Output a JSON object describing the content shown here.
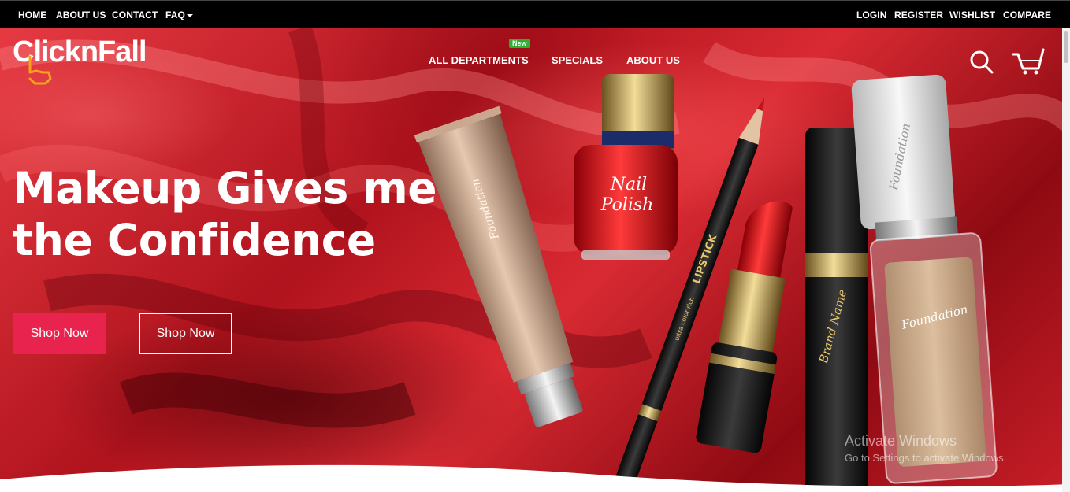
{
  "topbar": {
    "left_links": [
      "HOME",
      "ABOUT US",
      "CONTACT",
      "FAQ"
    ],
    "right_links": [
      "LOGIN",
      "REGISTER",
      "WISHLIST",
      "COMPARE"
    ]
  },
  "brand": {
    "logo_text": "ClicknFall"
  },
  "nav": {
    "items": [
      "ALL DEPARTMENTS",
      "SPECIALS",
      "ABOUT US"
    ],
    "new_badge": "New"
  },
  "header_icons": [
    "search-icon",
    "cart-icon"
  ],
  "hero": {
    "headline_line1": "Makeup Gives me",
    "headline_line2": "the Confidence",
    "primary_button": "Shop Now",
    "secondary_button": "Shop Now",
    "product_labels": {
      "tube": "Foundation",
      "nail_polish_line1": "Nail",
      "nail_polish_line2": "Polish",
      "pencil": "LIPSTICK",
      "pencil_small": "ultra color rich",
      "mascara": "Brand Name",
      "bottle": "Foundation",
      "bottle_cap": "Foundation"
    }
  },
  "watermark": {
    "title": "Activate Windows",
    "subtitle": "Go to Settings to activate Windows."
  },
  "colors": {
    "topbar_bg": "#000000",
    "hero_red": "#c81e28",
    "primary_button_bg": "#e8234e",
    "new_badge_bg": "#2bb12f"
  }
}
